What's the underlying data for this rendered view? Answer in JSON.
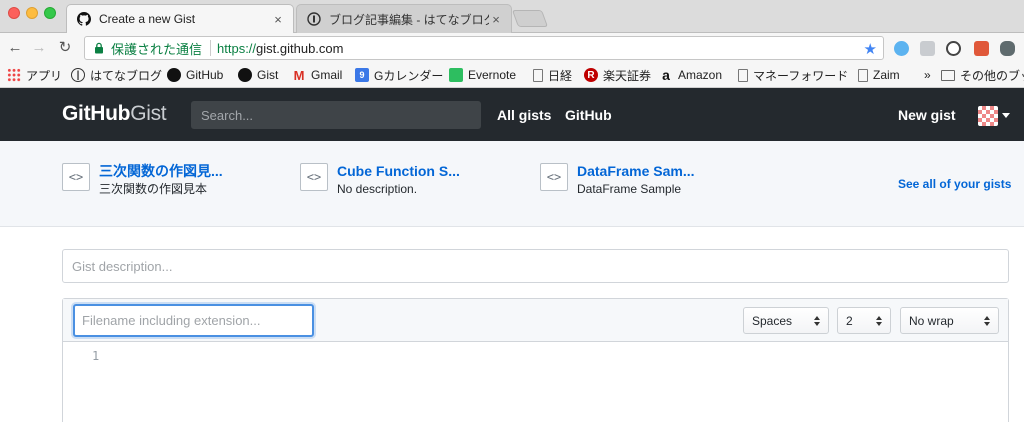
{
  "browser": {
    "tabs": [
      {
        "title": "Create a new Gist",
        "active": true,
        "close": "×"
      },
      {
        "title": "ブログ記事編集 - はてなブログ",
        "active": false,
        "close": "×"
      }
    ],
    "address": {
      "secure_label": "保護された通信",
      "url_scheme": "https://",
      "url_host": "gist.github.com"
    },
    "bookmarks": [
      {
        "label": "アプリ"
      },
      {
        "label": "はてなブログ"
      },
      {
        "label": "GitHub"
      },
      {
        "label": "Gist"
      },
      {
        "label": "Gmail"
      },
      {
        "label": "Gカレンダー"
      },
      {
        "label": "Evernote"
      },
      {
        "label": "日経"
      },
      {
        "label": "楽天証券"
      },
      {
        "label": "Amazon"
      },
      {
        "label": "マネーフォワード"
      },
      {
        "label": "Zaim"
      },
      {
        "label": "»"
      },
      {
        "label": "その他のブックマーク"
      }
    ]
  },
  "header": {
    "logo_bold": "GitHub",
    "logo_light": "Gist",
    "search_placeholder": "Search...",
    "nav": [
      "All gists",
      "GitHub"
    ],
    "new_gist": "New gist"
  },
  "recent_gists": [
    {
      "title": "三次関数の作図見...",
      "description": "三次関数の作図見本"
    },
    {
      "title": "Cube Function S...",
      "description": "No description."
    },
    {
      "title": "DataFrame Sam...",
      "description": "DataFrame Sample"
    }
  ],
  "see_all": "See all of your gists",
  "form": {
    "description_placeholder": "Gist description...",
    "filename_placeholder": "Filename including extension...",
    "indent_mode": "Spaces",
    "indent_size": "2",
    "wrap_mode": "No wrap",
    "line_number": "1"
  },
  "colors": {
    "header_bg": "#24292e",
    "link_blue": "#0366d6",
    "secure_green": "#0b8043",
    "focus_blue": "#4a90e2"
  }
}
